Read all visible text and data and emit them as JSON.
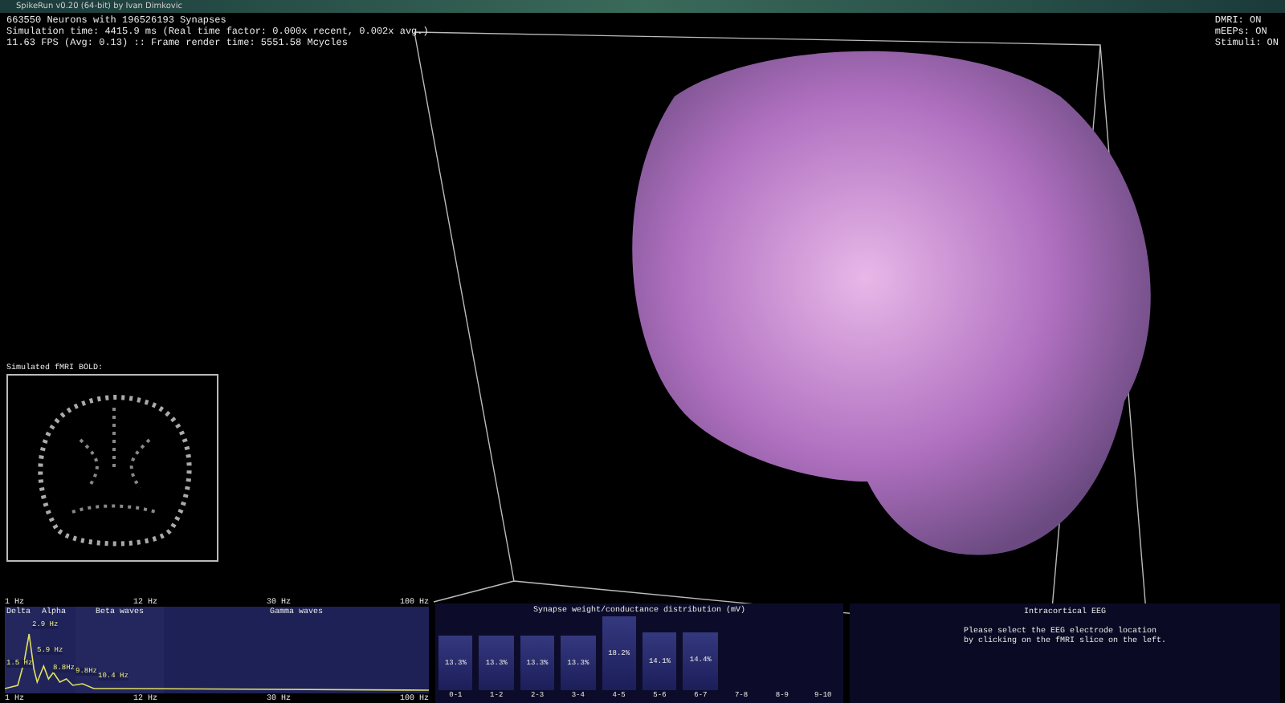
{
  "window": {
    "title": "SpikeRun v0.20 (64-bit) by Ivan Dimkovic"
  },
  "stats": [
    "663550 Neurons with 196526193 Synapses",
    "Simulation time: 4415.9 ms (Real time factor: 0.000x recent, 0.002x avg.)",
    "11.63 FPS (Avg: 0.13) :: Frame render time: 5551.58 Mcycles"
  ],
  "toggles": [
    {
      "label": "DMRI: ON"
    },
    {
      "label": "mEEPs: ON"
    },
    {
      "label": "Stimuli: ON"
    }
  ],
  "fmri": {
    "title": "Simulated fMRI BOLD:"
  },
  "spectrum": {
    "top_ticks": [
      "1 Hz",
      "12 Hz",
      "30 Hz",
      "100 Hz"
    ],
    "bottom_ticks": [
      "1 Hz",
      "12 Hz",
      "30 Hz",
      "100 Hz"
    ],
    "bands": [
      "Delta",
      "Alpha",
      "Beta waves",
      "Gamma waves"
    ],
    "peaks": [
      "2.9 Hz",
      "5.9 Hz",
      "1.5 Hz",
      "8.8Hz",
      "9.8Hz",
      "10.4 Hz"
    ]
  },
  "synapses": {
    "chart_data": {
      "type": "bar",
      "title": "Synapse weight/conductance distribution (mV)",
      "categories": [
        "0-1",
        "1-2",
        "2-3",
        "3-4",
        "4-5",
        "5-6",
        "6-7",
        "7-8",
        "8-9",
        "9-10"
      ],
      "values": [
        13.3,
        13.3,
        13.3,
        13.3,
        18.2,
        14.1,
        14.4,
        0,
        0,
        0
      ],
      "data_labels": true,
      "value_labels": [
        "13.3%",
        "13.3%",
        "13.3%",
        "13.3%",
        "18.2%",
        "14.1%",
        "14.4%",
        null,
        null,
        null
      ]
    }
  },
  "eeg": {
    "title": "Intracortical EEG",
    "message": [
      "Please select the EEG electrode location",
      "by clicking on the fMRI slice on the left."
    ]
  }
}
